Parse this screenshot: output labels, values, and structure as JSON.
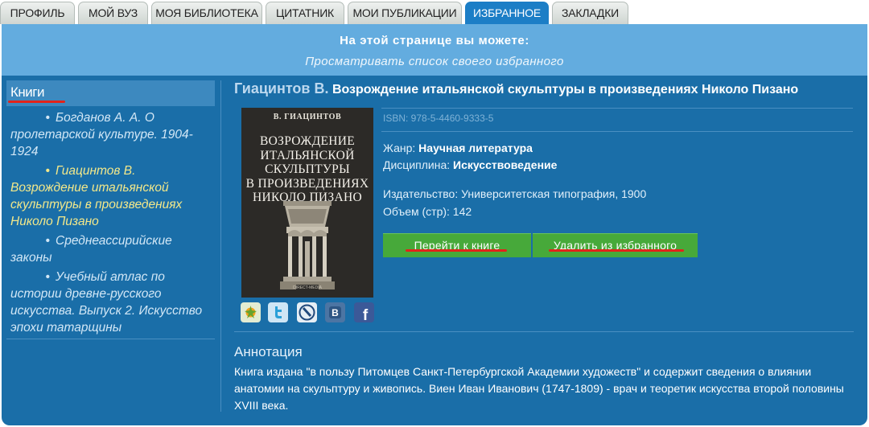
{
  "tabs": [
    {
      "label": "ПРОФИЛЬ"
    },
    {
      "label": "МОЙ ВУЗ"
    },
    {
      "label": "МОЯ БИБЛИОТЕКА"
    },
    {
      "label": "ЦИТАТНИК"
    },
    {
      "label": "МОИ ПУБЛИКАЦИИ"
    },
    {
      "label": "ИЗБРАННОЕ",
      "active": true
    },
    {
      "label": "ЗАКЛАДКИ"
    }
  ],
  "banner": {
    "heading": "На этой странице вы можете:",
    "subtitle": "Просматривать список своего избранного"
  },
  "sidebar": {
    "heading": "Книги",
    "bullet": "•",
    "items": [
      {
        "label": "Богданов А. А. О пролетарской культуре. 1904-1924"
      },
      {
        "label": "Гиацинтов В. Возрождение итальянской скульптуры в произведениях Николо Пизано",
        "current": true
      },
      {
        "label": "Среднеассирийские законы"
      },
      {
        "label": "Учебный атлас по истории древне-русского искусства. Выпуск 2. Искусство эпохи татарщины"
      }
    ]
  },
  "book": {
    "author": "Гиацинтов В.",
    "title": "Возрождение итальянской скульптуры в произведениях Николо Пизано",
    "cover": {
      "author": "В. ГИАЦИНТОВ",
      "title_lines": [
        "ВОЗРОЖДЕНИЕ",
        "ИТАЛЬЯНСКОЙ",
        "СКУЛЬПТУРЫ",
        "В ПРОИЗВЕДЕНИЯХ",
        "НИКОЛО ПИЗАНО"
      ]
    },
    "isbn": "ISBN: 978-5-4460-9333-5",
    "genre_label": "Жанр:",
    "genre": "Научная литература",
    "discipline_label": "Дисциплина:",
    "discipline": "Искусствоведение",
    "publisher": "Издательство: Университетская типография, 1900",
    "pages": "Объем (стр): 142"
  },
  "buttons": {
    "goto": "Перейти к книге",
    "remove": "Удалить из избранного"
  },
  "social": [
    {
      "icon": "share-icon",
      "color": "#e3ecd2"
    },
    {
      "icon": "twitter-icon",
      "color": "#cfe6f5"
    },
    {
      "icon": "livejournal-icon",
      "color": "#e6eef5"
    },
    {
      "icon": "vkontakte-icon",
      "color": "#4c75a3"
    },
    {
      "icon": "facebook-icon",
      "color": "#3b5998"
    }
  ],
  "annotation": {
    "heading": "Аннотация",
    "text": "Книга издана \"в пользу Питомцев Санкт-Петербургской Академии художеств\" и содержит сведения о влиянии анатомии на скульптуру и живопись. Виен Иван Иванович (1747-1809) - врач и теоретик искусства второй половины XVIII века."
  }
}
